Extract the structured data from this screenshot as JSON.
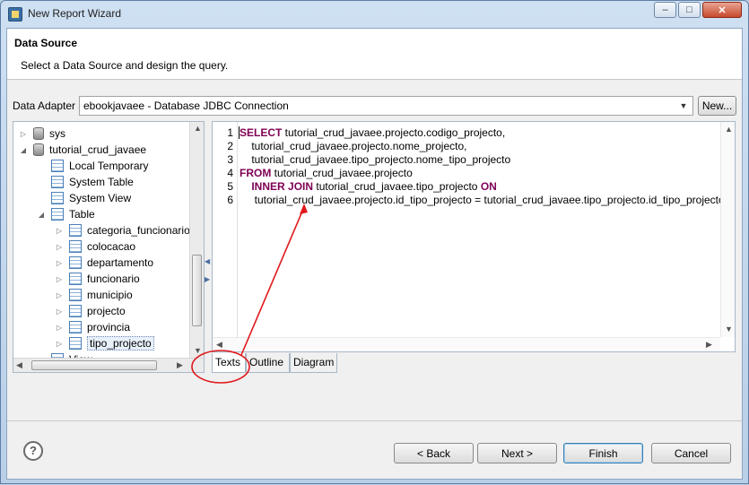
{
  "window": {
    "title": "New Report Wizard",
    "buttons": {
      "minimize": "‒",
      "maximize": "□",
      "close": "✕"
    }
  },
  "header": {
    "title": "Data Source",
    "description": "Select a Data Source and design the query."
  },
  "adapter": {
    "label": "Data Adapter",
    "value": "ebookjavaee - Database JDBC Connection",
    "new_button": "New..."
  },
  "tree": {
    "items": [
      {
        "label": "sys",
        "icon": "database-icon",
        "level": 1,
        "twisty": "▷"
      },
      {
        "label": "tutorial_crud_javaee",
        "icon": "database-icon",
        "level": 1,
        "twisty": "◢"
      },
      {
        "label": "Local Temporary",
        "icon": "table-icon",
        "level": 2,
        "twisty": ""
      },
      {
        "label": "System Table",
        "icon": "table-icon",
        "level": 2,
        "twisty": ""
      },
      {
        "label": "System View",
        "icon": "table-icon",
        "level": 2,
        "twisty": ""
      },
      {
        "label": "Table",
        "icon": "table-icon",
        "level": 2,
        "twisty": "◢"
      },
      {
        "label": "categoria_funcionario",
        "icon": "table-icon",
        "level": 3,
        "twisty": "▷"
      },
      {
        "label": "colocacao",
        "icon": "table-icon",
        "level": 3,
        "twisty": "▷"
      },
      {
        "label": "departamento",
        "icon": "table-icon",
        "level": 3,
        "twisty": "▷"
      },
      {
        "label": "funcionario",
        "icon": "table-icon",
        "level": 3,
        "twisty": "▷"
      },
      {
        "label": "municipio",
        "icon": "table-icon",
        "level": 3,
        "twisty": "▷"
      },
      {
        "label": "projecto",
        "icon": "table-icon",
        "level": 3,
        "twisty": "▷"
      },
      {
        "label": "provincia",
        "icon": "table-icon",
        "level": 3,
        "twisty": "▷"
      },
      {
        "label": "tipo_projecto",
        "icon": "table-icon",
        "level": 3,
        "twisty": "▷",
        "selected": true
      },
      {
        "label": "View",
        "icon": "table-icon",
        "level": 2,
        "twisty": ""
      }
    ]
  },
  "editor": {
    "lines": [
      {
        "n": "1",
        "parts": [
          {
            "t": "SELECT",
            "kw": true
          },
          {
            "t": " tutorial_crud_javaee.projecto.codigo_projecto,"
          }
        ]
      },
      {
        "n": "2",
        "parts": [
          {
            "t": "    tutorial_crud_javaee.projecto.nome_projecto,"
          }
        ]
      },
      {
        "n": "3",
        "parts": [
          {
            "t": "    tutorial_crud_javaee.tipo_projecto.nome_tipo_projecto"
          }
        ]
      },
      {
        "n": "4",
        "parts": [
          {
            "t": "FROM",
            "kw": true
          },
          {
            "t": " tutorial_crud_javaee.projecto"
          }
        ]
      },
      {
        "n": "5",
        "parts": [
          {
            "t": "    "
          },
          {
            "t": "INNER JOIN",
            "kw": true
          },
          {
            "t": " tutorial_crud_javaee.tipo_projecto "
          },
          {
            "t": "ON",
            "kw": true
          }
        ]
      },
      {
        "n": "6",
        "parts": [
          {
            "t": "     tutorial_crud_javaee.projecto.id_tipo_projecto = tutorial_crud_javaee.tipo_projecto.id_tipo_projecto"
          }
        ]
      }
    ]
  },
  "tabs": [
    "Texts",
    "Outline",
    "Diagram"
  ],
  "footer": {
    "help": "?",
    "back": "< Back",
    "next": "Next >",
    "finish": "Finish",
    "cancel": "Cancel"
  },
  "colors": {
    "keyword": "#7f0055",
    "annotation": "#e0191c"
  }
}
